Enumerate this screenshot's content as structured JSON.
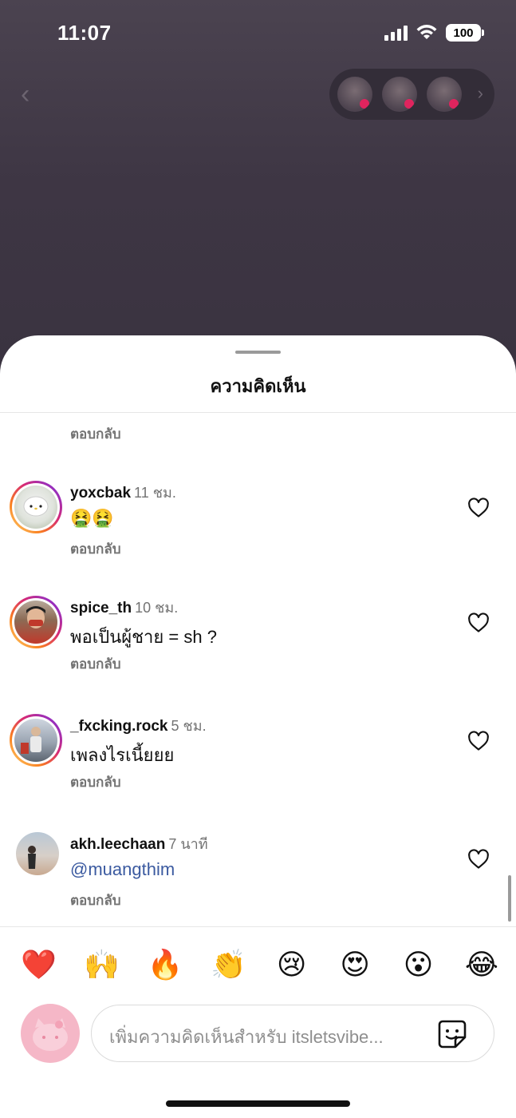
{
  "status_bar": {
    "time": "11:07",
    "battery": "100"
  },
  "header": {
    "title": "ความคิดเห็น"
  },
  "top_reply_label": "ตอบกลับ",
  "comments": [
    {
      "username": "yoxcbak",
      "time_ago": "11 ชม.",
      "text": "🤮🤮",
      "reply": "ตอบกลับ"
    },
    {
      "username": "spice_th",
      "time_ago": "10 ชม.",
      "text": "พอเป็นผู้ชาย = sh ?",
      "reply": "ตอบกลับ"
    },
    {
      "username": "_fxcking.rock",
      "time_ago": "5 ชม.",
      "text": "เพลงไรเนี้ยยย",
      "reply": "ตอบกลับ"
    },
    {
      "username": "akh.leechaan",
      "time_ago": "7 นาที",
      "text": "@muangthim",
      "reply": "ตอบกลับ"
    }
  ],
  "emoji_bar": [
    "❤️",
    "🙌",
    "🔥",
    "👏",
    "😢",
    "😍",
    "😮",
    "😂"
  ],
  "input": {
    "placeholder": "เพิ่มความคิดเห็นสำหรับ itsletsvibe..."
  },
  "colors": {
    "mention": "#3b5aa0",
    "muted": "#737373",
    "like_heart": "#111111"
  }
}
